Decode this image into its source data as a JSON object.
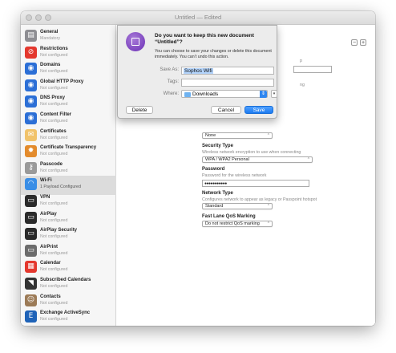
{
  "window": {
    "title": "Untitled — Edited"
  },
  "sidebar": {
    "items": [
      {
        "name": "General",
        "sub": "Mandatory",
        "icon": "general-icon",
        "color": "#8e8e93"
      },
      {
        "name": "Restrictions",
        "sub": "Not configured",
        "icon": "restrictions-icon",
        "color": "#e4382e"
      },
      {
        "name": "Domains",
        "sub": "Not configured",
        "icon": "globe-icon",
        "color": "#2c6fd6"
      },
      {
        "name": "Global HTTP Proxy",
        "sub": "Not configured",
        "icon": "globe-icon",
        "color": "#2c6fd6"
      },
      {
        "name": "DNS Proxy",
        "sub": "Not configured",
        "icon": "globe-icon",
        "color": "#2c6fd6"
      },
      {
        "name": "Content Filter",
        "sub": "Not configured",
        "icon": "globe-icon",
        "color": "#2c6fd6"
      },
      {
        "name": "Certificates",
        "sub": "Not configured",
        "icon": "certificate-icon",
        "color": "#f1c36b"
      },
      {
        "name": "Certificate Transparency",
        "sub": "Not configured",
        "icon": "gear-icon",
        "color": "#e38b2c"
      },
      {
        "name": "Passcode",
        "sub": "Not configured",
        "icon": "key-icon",
        "color": "#9a9a9a"
      },
      {
        "name": "Wi-Fi",
        "sub": "1 Payload Configured",
        "icon": "wifi-icon",
        "color": "#3a8ee6"
      },
      {
        "name": "VPN",
        "sub": "Not configured",
        "icon": "vpn-icon",
        "color": "#2b2b2b"
      },
      {
        "name": "AirPlay",
        "sub": "Not configured",
        "icon": "airplay-icon",
        "color": "#2b2b2b"
      },
      {
        "name": "AirPlay Security",
        "sub": "Not configured",
        "icon": "airplay-icon",
        "color": "#2b2b2b"
      },
      {
        "name": "AirPrint",
        "sub": "Not configured",
        "icon": "printer-icon",
        "color": "#6c6c6c"
      },
      {
        "name": "Calendar",
        "sub": "Not configured",
        "icon": "calendar-icon",
        "color": "#e4382e"
      },
      {
        "name": "Subscribed Calendars",
        "sub": "Not configured",
        "icon": "rss-icon",
        "color": "#333333"
      },
      {
        "name": "Contacts",
        "sub": "Not configured",
        "icon": "contacts-icon",
        "color": "#9c7b57"
      },
      {
        "name": "Exchange ActiveSync",
        "sub": "Not configured",
        "icon": "exchange-icon",
        "color": "#1f63b8"
      }
    ]
  },
  "main": {
    "proxy_value": "None",
    "security_type_label": "Security Type",
    "security_type_hint": "Wireless network encryption to use when connecting",
    "security_type_value": "WPA / WPA2 Personal",
    "password_label": "Password",
    "password_hint": "Password for the wireless network",
    "password_value": "●●●●●●●●●●●",
    "network_type_label": "Network Type",
    "network_type_hint": "Configures network to appear as legacy or Passpoint hotspot",
    "network_type_value": "Standard",
    "qos_label": "Fast Lane QoS Marking",
    "qos_value": "Do not restrict QoS marking",
    "partial_hint_1": "p",
    "partial_hint_2": "ng",
    "minus": "−",
    "plus": "+"
  },
  "sheet": {
    "title": "Do you want to keep this new document “Untitled”?",
    "body": "You can choose to save your changes or delete this document immediately. You can’t undo this action.",
    "save_as_label": "Save As:",
    "save_as_value": "Sophos Wifi",
    "tags_label": "Tags:",
    "tags_value": "",
    "where_label": "Where:",
    "where_value": "Downloads",
    "delete_label": "Delete",
    "cancel_label": "Cancel",
    "save_label": "Save"
  }
}
